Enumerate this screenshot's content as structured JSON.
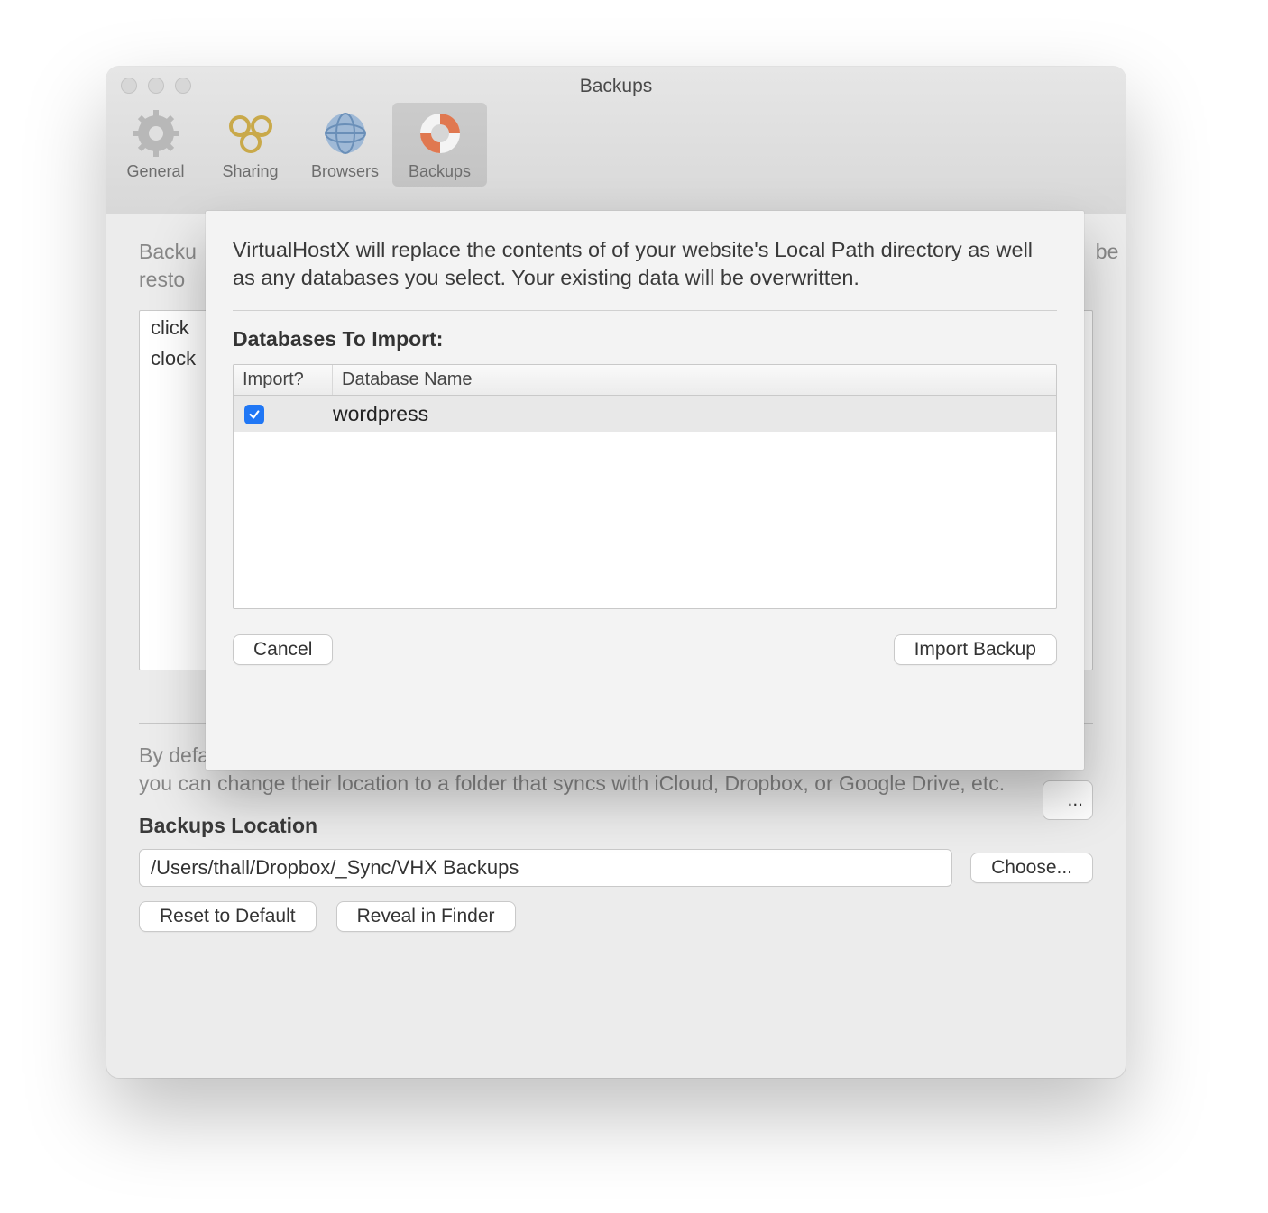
{
  "window": {
    "title": "Backups"
  },
  "toolbar": {
    "items": [
      {
        "label": "General"
      },
      {
        "label": "Sharing"
      },
      {
        "label": "Browsers"
      },
      {
        "label": "Backups"
      }
    ],
    "active_index": 3
  },
  "background": {
    "intro_partial": "Backu                                                                                                                                                            be\nresto",
    "list_items": [
      "click",
      "clock"
    ],
    "peek_button_suffix": "...",
    "sync_description": "By default, your backups are stored locally only on your Mac. However, to enable extra awesomeness, you can change their location to a folder that syncs with iCloud, Dropbox, or Google Drive, etc.",
    "location_heading": "Backups Location",
    "location_path": "/Users/thall/Dropbox/_Sync/VHX Backups",
    "choose_label": "Choose...",
    "reset_label": "Reset to Default",
    "reveal_label": "Reveal in Finder"
  },
  "sheet": {
    "message": "VirtualHostX will replace the contents of of your website's Local Path directory as well as any databases you select. Your existing data will be overwritten.",
    "heading": "Databases To Import:",
    "columns": {
      "import": "Import?",
      "name": "Database Name"
    },
    "rows": [
      {
        "checked": true,
        "name": "wordpress"
      }
    ],
    "cancel_label": "Cancel",
    "import_label": "Import Backup"
  }
}
